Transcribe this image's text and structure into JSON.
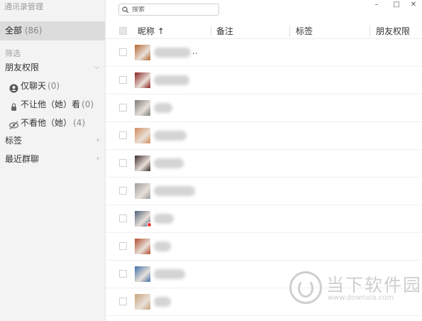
{
  "app": {
    "title": "通讯录管理"
  },
  "window_controls": {
    "minimize": "–",
    "maximize": "□",
    "close": "✕"
  },
  "sidebar": {
    "all": {
      "label": "全部",
      "count": "(86)"
    },
    "filter_title": "筛选",
    "friend_permissions": {
      "label": "朋友权限"
    },
    "permission_items": [
      {
        "label": "仅聊天",
        "count": "(0)",
        "icon": "chat-only-icon"
      },
      {
        "label": "不让他（她）看",
        "count": "(0)",
        "icon": "hide-from-icon"
      },
      {
        "label": "不看他（她）",
        "count": "(4)",
        "icon": "dont-see-icon"
      }
    ],
    "tags": {
      "label": "标签"
    },
    "recent_groups": {
      "label": "最近群聊"
    }
  },
  "search": {
    "placeholder": "搜索"
  },
  "table": {
    "columns": {
      "nickname": "昵称 ↑",
      "remark": "备注",
      "tags": "标签",
      "friend_permission": "朋友权限"
    },
    "rows": [
      {
        "avatar_color": "#b5652e",
        "nick_suffix": ".."
      },
      {
        "avatar_color": "#8b1e1e",
        "nick_suffix": ""
      },
      {
        "avatar_color": "#7a7a7a",
        "nick_suffix": ""
      },
      {
        "avatar_color": "#d08a5a",
        "nick_suffix": ""
      },
      {
        "avatar_color": "#3a2a2a",
        "nick_suffix": ""
      },
      {
        "avatar_color": "#9c9c9c",
        "nick_suffix": ""
      },
      {
        "avatar_color": "#4e5f78",
        "nick_suffix": "",
        "badge": true
      },
      {
        "avatar_color": "#b04a2a",
        "nick_suffix": ""
      },
      {
        "avatar_color": "#3f6ea8",
        "nick_suffix": ""
      },
      {
        "avatar_color": "#c9a27a",
        "nick_suffix": ""
      }
    ]
  },
  "watermark": {
    "text": "当下软件园",
    "url": "www.downxia.com"
  }
}
